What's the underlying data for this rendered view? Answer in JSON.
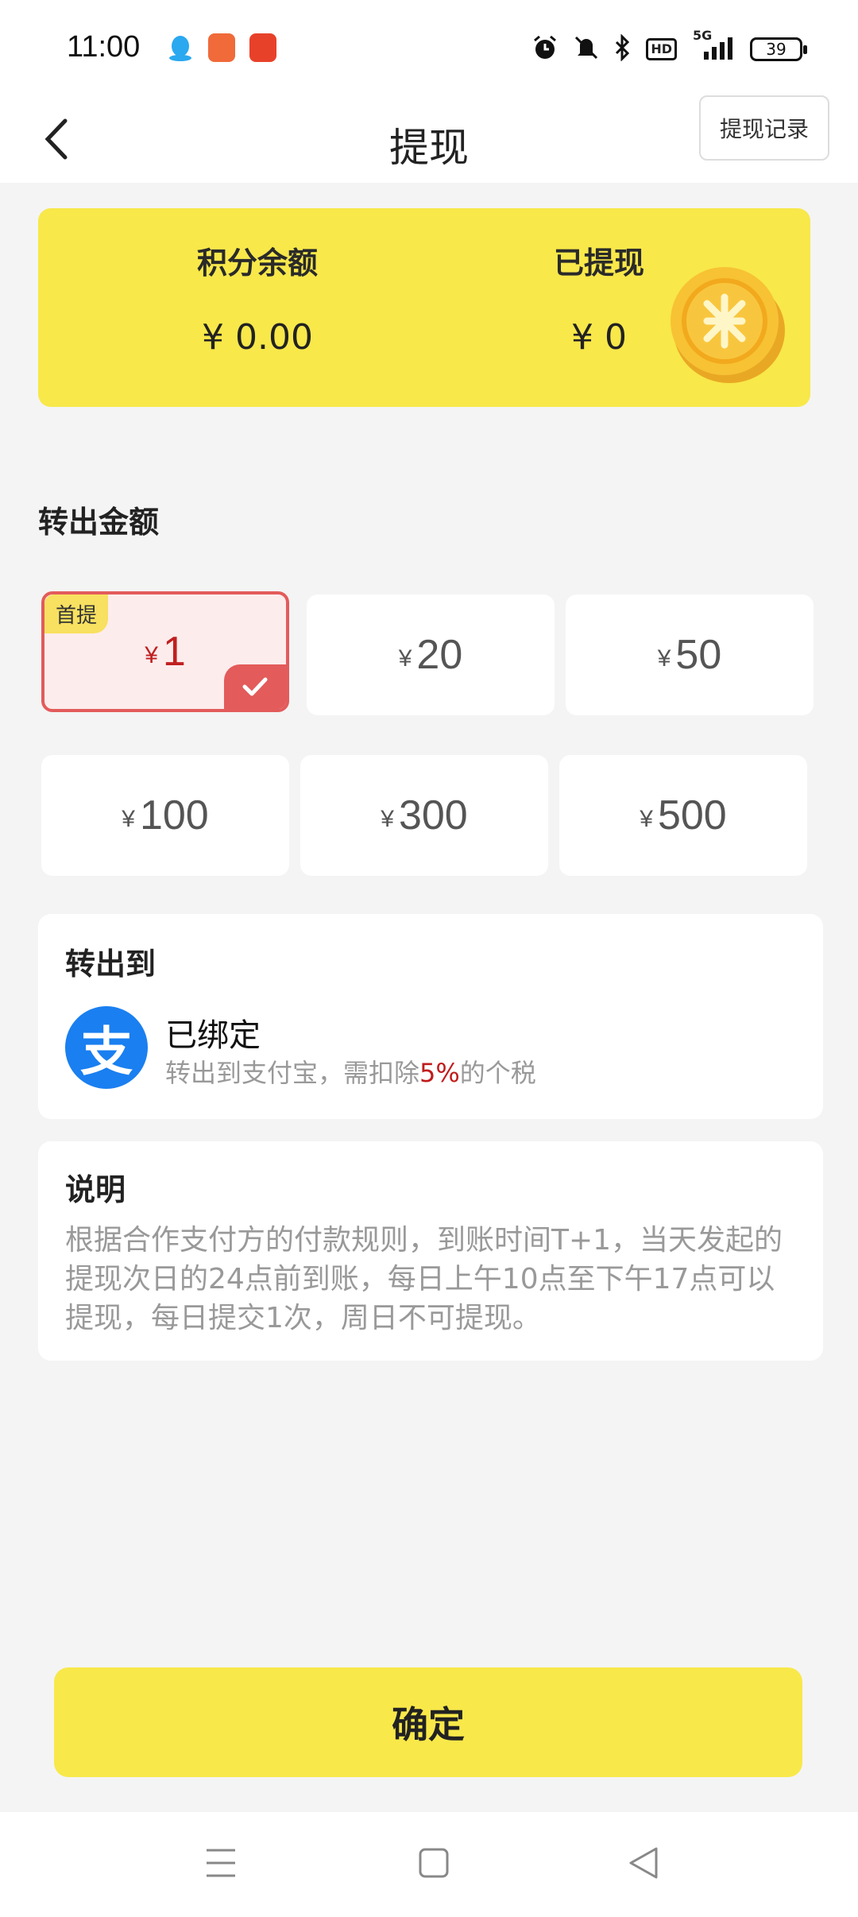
{
  "status_bar": {
    "time": "11:00",
    "battery": "39",
    "network": "5G",
    "hd": "HD"
  },
  "nav": {
    "title": "提现",
    "record_button": "提现记录"
  },
  "balance": {
    "points_label": "积分余额",
    "points_value": "¥ 0.00",
    "withdrawn_label": "已提现",
    "withdrawn_value": "¥ 0"
  },
  "amount_section": {
    "title": "转出金额",
    "currency_symbol": "¥",
    "options": [
      {
        "value": "1",
        "badge": "首提",
        "selected": true
      },
      {
        "value": "20",
        "selected": false
      },
      {
        "value": "50",
        "selected": false
      },
      {
        "value": "100",
        "selected": false
      },
      {
        "value": "300",
        "selected": false
      },
      {
        "value": "500",
        "selected": false
      }
    ]
  },
  "transfer_to": {
    "title": "转出到",
    "alipay_glyph": "支",
    "status": "已绑定",
    "note_prefix": "转出到支付宝，需扣除",
    "note_rate": "5%",
    "note_suffix": "的个税"
  },
  "description": {
    "title": "说明",
    "text": "根据合作支付方的付款规则，到账时间T+1，当天发起的提现次日的24点前到账，每日上午10点至下午17点可以提现，每日提交1次，周日不可提现。"
  },
  "confirm_label": "确定",
  "colors": {
    "accent_yellow": "#f8e84a",
    "selected_red": "#e35b5b",
    "alipay_blue": "#1a7ff0"
  }
}
